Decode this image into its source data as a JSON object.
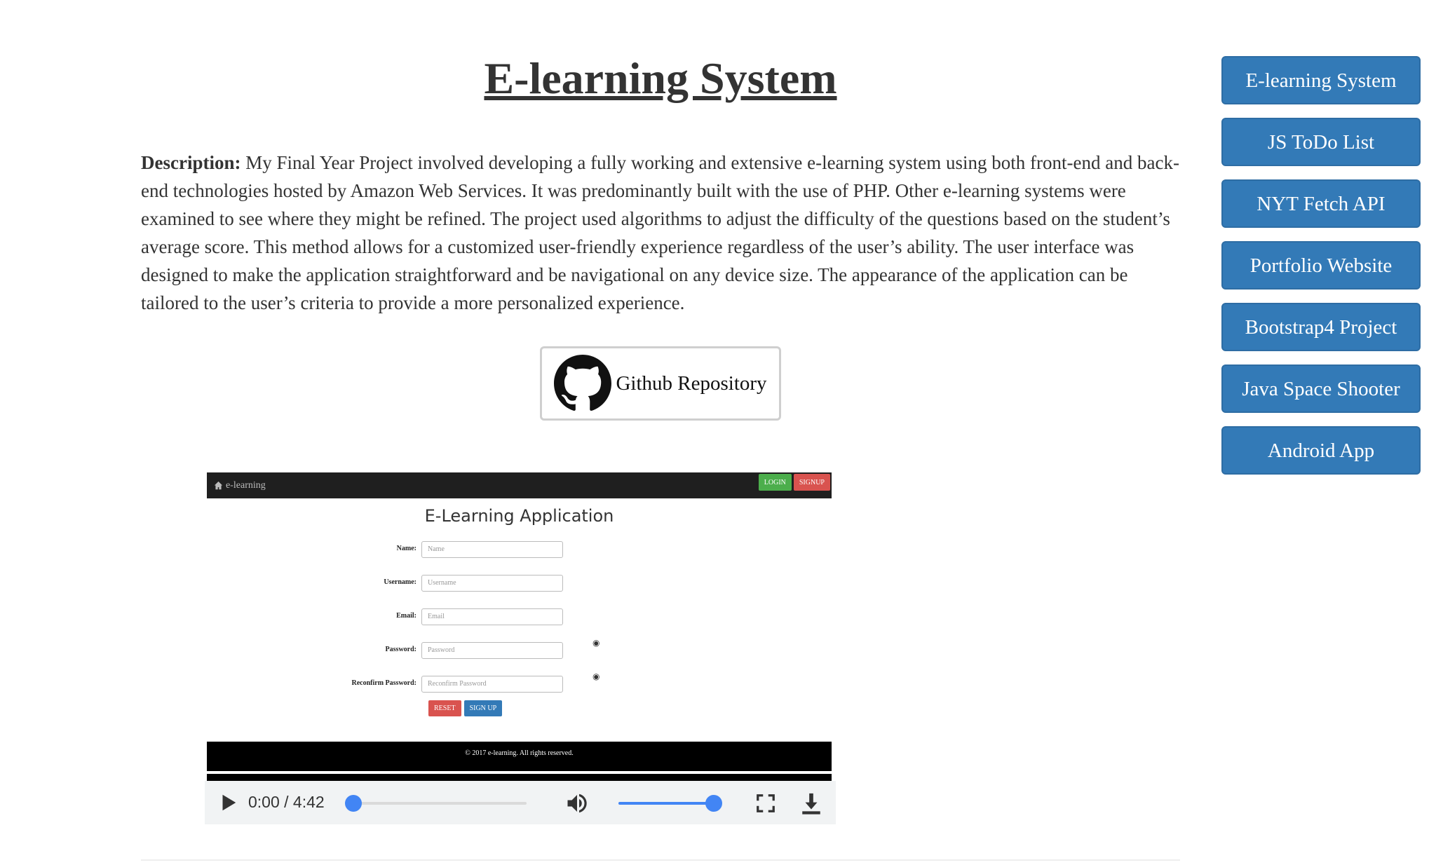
{
  "page": {
    "title": "E-learning System",
    "description_label": "Description:",
    "description_text": " My Final Year Project involved developing a fully working and extensive e-learning system using both front-end and back-end technologies hosted by Amazon Web Services. It was predominantly built with the use of PHP. Other e-learning systems were examined to see where they might be refined. The project used algorithms to adjust the difficulty of the questions based on the student’s average score. This method allows for a customized user-friendly experience regardless of the user’s ability. The user interface was designed to make the application straightforward and be navigational on any device size. The appearance of the application can be tailored to the user’s criteria to provide a more personalized experience.",
    "github_label": "Github Repository"
  },
  "video": {
    "app": {
      "brand": "e-learning",
      "login_label": "LOGIN",
      "signup_top_label": "SIGNUP",
      "title": "E-Learning Application",
      "fields": [
        {
          "label": "Name:",
          "placeholder": "Name"
        },
        {
          "label": "Username:",
          "placeholder": "Username"
        },
        {
          "label": "Email:",
          "placeholder": "Email"
        },
        {
          "label": "Password:",
          "placeholder": "Password"
        },
        {
          "label": "Reconfirm Password:",
          "placeholder": "Reconfirm Password"
        }
      ],
      "reset_label": "RESET",
      "signup_label": "SIGN UP",
      "footer": "© 2017 e-learning. All rights reserved."
    },
    "player": {
      "time": "0:00 / 4:42",
      "progress": 0,
      "volume": 1.0
    }
  },
  "sidebar": {
    "items": [
      "E-learning System",
      "JS ToDo List",
      "NYT Fetch API",
      "Portfolio Website",
      "Bootstrap4 Project",
      "Java Space Shooter",
      "Android App"
    ]
  },
  "colors": {
    "primary": "#337ab7",
    "success": "#4cae4c",
    "danger": "#d9534f",
    "player_accent": "#4285f4"
  }
}
